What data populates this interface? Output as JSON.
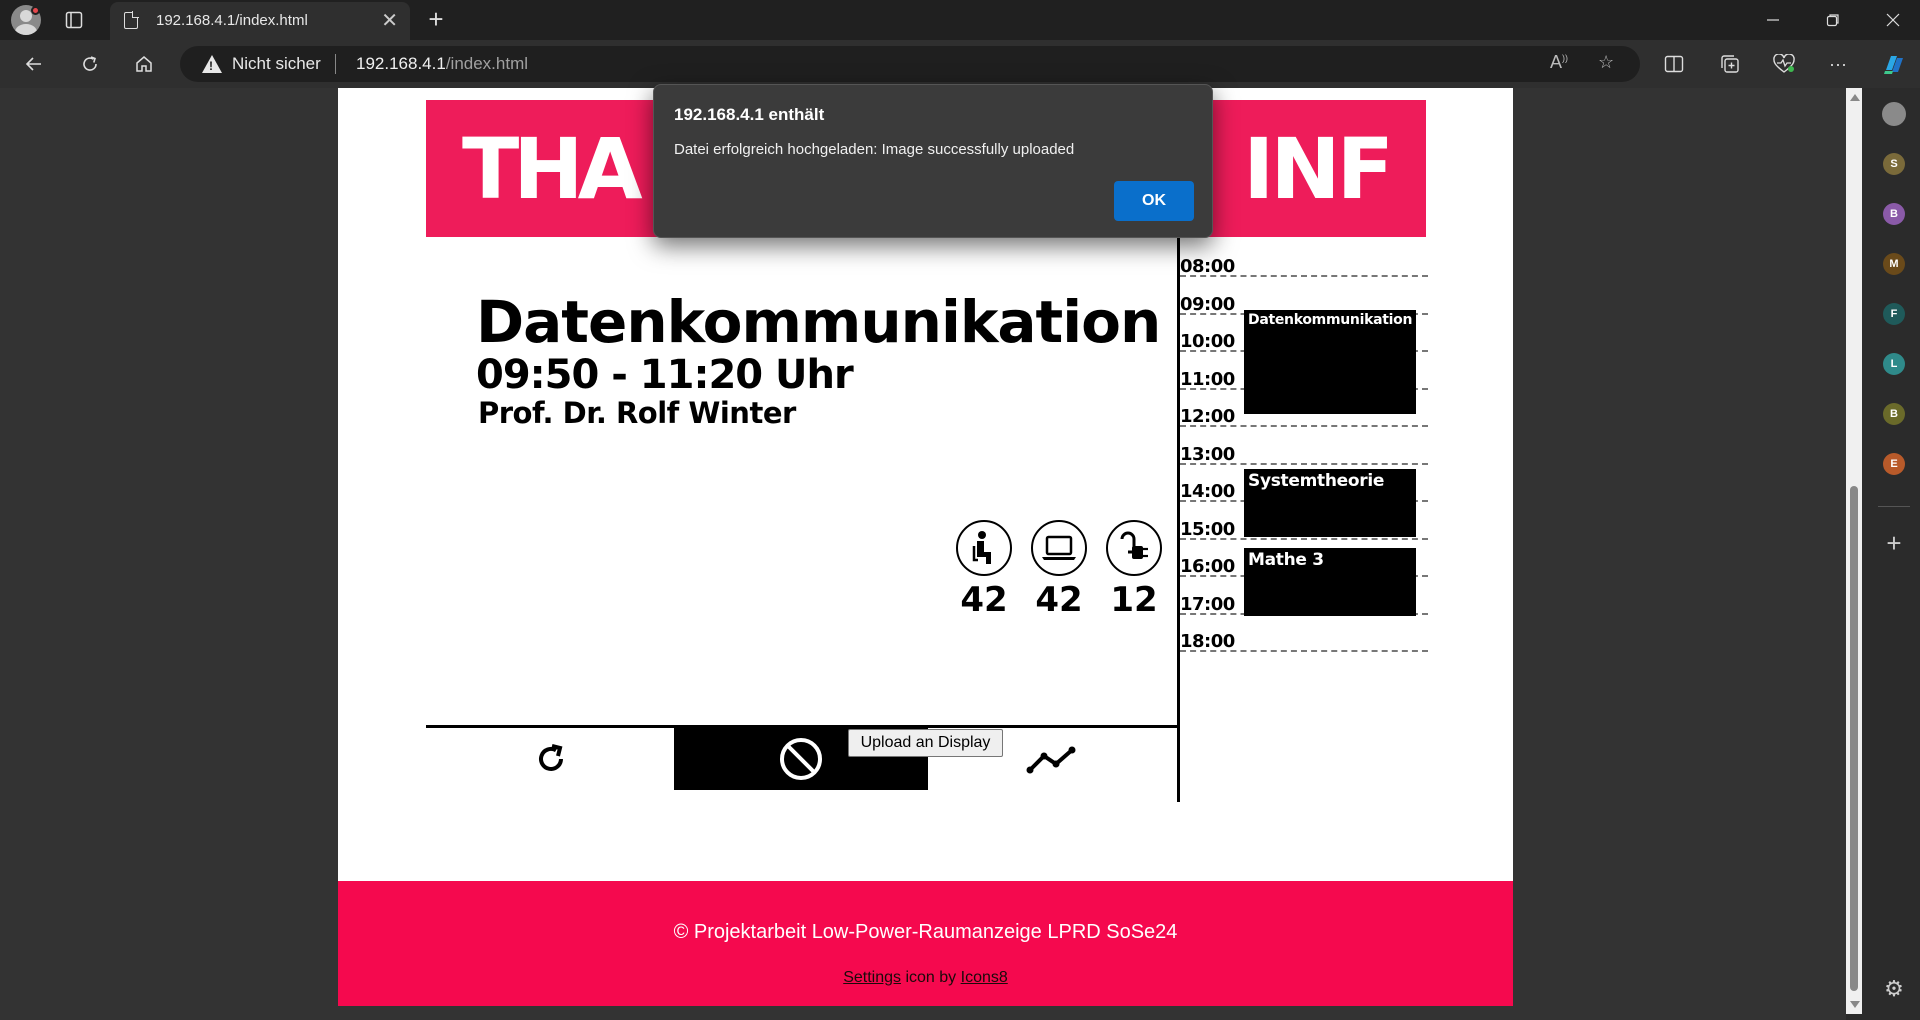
{
  "browser": {
    "tab_title": "192.168.4.1/index.html",
    "security_label": "Nicht sicher",
    "url_host": "192.168.4.1",
    "url_path": "/index.html"
  },
  "sidebar_profiles": [
    {
      "letter": "S",
      "color": "#7a6a3a"
    },
    {
      "letter": "B",
      "color": "#8a5aa8"
    },
    {
      "letter": "M",
      "color": "#6a4a1a"
    },
    {
      "letter": "F",
      "color": "#1f5a5a"
    },
    {
      "letter": "L",
      "color": "#2f8a8a"
    },
    {
      "letter": "B",
      "color": "#6a6a2a"
    },
    {
      "letter": "E",
      "color": "#b85a2a"
    }
  ],
  "display": {
    "logo_left": "THA",
    "logo_right": "INF",
    "course": "Datenkommunikation",
    "time": "09:50 - 11:20 Uhr",
    "professor": "Prof. Dr. Rolf Winter",
    "resources": [
      {
        "icon": "seat-icon",
        "value": "42"
      },
      {
        "icon": "laptop-icon",
        "value": "42"
      },
      {
        "icon": "power-plug-icon",
        "value": "12"
      }
    ],
    "timeline": [
      "08:00",
      "09:00",
      "10:00",
      "11:00",
      "12:00",
      "13:00",
      "14:00",
      "15:00",
      "16:00",
      "17:00",
      "18:00"
    ],
    "events": [
      {
        "name": "Datenkommunikation"
      },
      {
        "name": "Systemtheorie"
      },
      {
        "name": "Mathe 3"
      }
    ],
    "banner_color": "#ee1c5a"
  },
  "upload_button": "Upload an Display",
  "footer": {
    "copyright": "© Projektarbeit Low-Power-Raumanzeige LPRD SoSe24",
    "credit_link1": "Settings",
    "credit_mid": " icon by ",
    "credit_link2": "Icons8",
    "color": "#f5094e"
  },
  "dialog": {
    "title": "192.168.4.1 enthält",
    "message": "Datei erfolgreich hochgeladen: Image successfully uploaded",
    "ok_label": "OK"
  }
}
